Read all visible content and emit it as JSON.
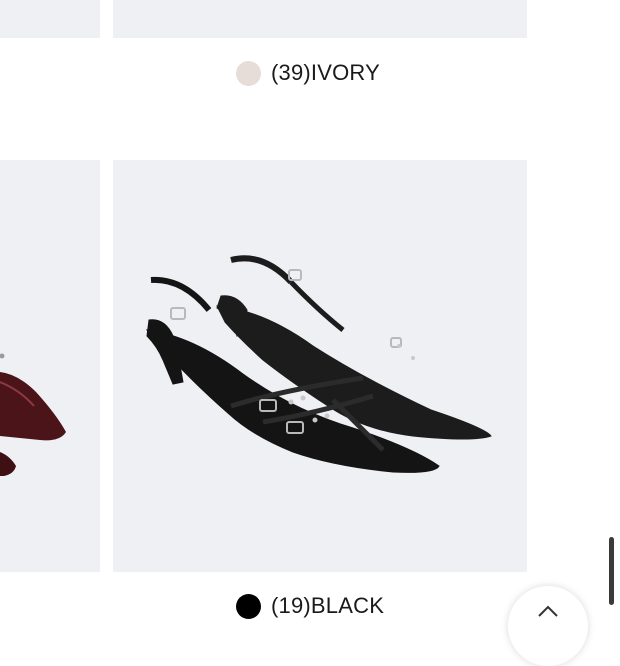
{
  "products": [
    {
      "color_code": "(39)IVORY",
      "swatch_color": "#e6dcd8"
    },
    {
      "color_code": "(19)BLACK",
      "swatch_color": "#000000"
    }
  ],
  "icons": {
    "swatch_ivory": "color-swatch",
    "swatch_black": "color-swatch",
    "back_to_top": "arrow-up-icon"
  },
  "colors": {
    "tile_background": "#eef0f3",
    "shoe_black": "#1c1c1c",
    "shoe_burgundy": "#4a1418"
  }
}
